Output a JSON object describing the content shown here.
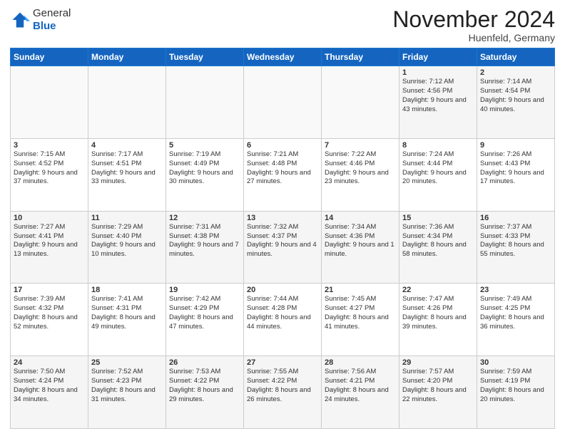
{
  "logo": {
    "general": "General",
    "blue": "Blue"
  },
  "title": "November 2024",
  "location": "Huenfeld, Germany",
  "headers": [
    "Sunday",
    "Monday",
    "Tuesday",
    "Wednesday",
    "Thursday",
    "Friday",
    "Saturday"
  ],
  "weeks": [
    [
      {
        "day": "",
        "info": ""
      },
      {
        "day": "",
        "info": ""
      },
      {
        "day": "",
        "info": ""
      },
      {
        "day": "",
        "info": ""
      },
      {
        "day": "",
        "info": ""
      },
      {
        "day": "1",
        "info": "Sunrise: 7:12 AM\nSunset: 4:56 PM\nDaylight: 9 hours and 43 minutes."
      },
      {
        "day": "2",
        "info": "Sunrise: 7:14 AM\nSunset: 4:54 PM\nDaylight: 9 hours and 40 minutes."
      }
    ],
    [
      {
        "day": "3",
        "info": "Sunrise: 7:15 AM\nSunset: 4:52 PM\nDaylight: 9 hours and 37 minutes."
      },
      {
        "day": "4",
        "info": "Sunrise: 7:17 AM\nSunset: 4:51 PM\nDaylight: 9 hours and 33 minutes."
      },
      {
        "day": "5",
        "info": "Sunrise: 7:19 AM\nSunset: 4:49 PM\nDaylight: 9 hours and 30 minutes."
      },
      {
        "day": "6",
        "info": "Sunrise: 7:21 AM\nSunset: 4:48 PM\nDaylight: 9 hours and 27 minutes."
      },
      {
        "day": "7",
        "info": "Sunrise: 7:22 AM\nSunset: 4:46 PM\nDaylight: 9 hours and 23 minutes."
      },
      {
        "day": "8",
        "info": "Sunrise: 7:24 AM\nSunset: 4:44 PM\nDaylight: 9 hours and 20 minutes."
      },
      {
        "day": "9",
        "info": "Sunrise: 7:26 AM\nSunset: 4:43 PM\nDaylight: 9 hours and 17 minutes."
      }
    ],
    [
      {
        "day": "10",
        "info": "Sunrise: 7:27 AM\nSunset: 4:41 PM\nDaylight: 9 hours and 13 minutes."
      },
      {
        "day": "11",
        "info": "Sunrise: 7:29 AM\nSunset: 4:40 PM\nDaylight: 9 hours and 10 minutes."
      },
      {
        "day": "12",
        "info": "Sunrise: 7:31 AM\nSunset: 4:38 PM\nDaylight: 9 hours and 7 minutes."
      },
      {
        "day": "13",
        "info": "Sunrise: 7:32 AM\nSunset: 4:37 PM\nDaylight: 9 hours and 4 minutes."
      },
      {
        "day": "14",
        "info": "Sunrise: 7:34 AM\nSunset: 4:36 PM\nDaylight: 9 hours and 1 minute."
      },
      {
        "day": "15",
        "info": "Sunrise: 7:36 AM\nSunset: 4:34 PM\nDaylight: 8 hours and 58 minutes."
      },
      {
        "day": "16",
        "info": "Sunrise: 7:37 AM\nSunset: 4:33 PM\nDaylight: 8 hours and 55 minutes."
      }
    ],
    [
      {
        "day": "17",
        "info": "Sunrise: 7:39 AM\nSunset: 4:32 PM\nDaylight: 8 hours and 52 minutes."
      },
      {
        "day": "18",
        "info": "Sunrise: 7:41 AM\nSunset: 4:31 PM\nDaylight: 8 hours and 49 minutes."
      },
      {
        "day": "19",
        "info": "Sunrise: 7:42 AM\nSunset: 4:29 PM\nDaylight: 8 hours and 47 minutes."
      },
      {
        "day": "20",
        "info": "Sunrise: 7:44 AM\nSunset: 4:28 PM\nDaylight: 8 hours and 44 minutes."
      },
      {
        "day": "21",
        "info": "Sunrise: 7:45 AM\nSunset: 4:27 PM\nDaylight: 8 hours and 41 minutes."
      },
      {
        "day": "22",
        "info": "Sunrise: 7:47 AM\nSunset: 4:26 PM\nDaylight: 8 hours and 39 minutes."
      },
      {
        "day": "23",
        "info": "Sunrise: 7:49 AM\nSunset: 4:25 PM\nDaylight: 8 hours and 36 minutes."
      }
    ],
    [
      {
        "day": "24",
        "info": "Sunrise: 7:50 AM\nSunset: 4:24 PM\nDaylight: 8 hours and 34 minutes."
      },
      {
        "day": "25",
        "info": "Sunrise: 7:52 AM\nSunset: 4:23 PM\nDaylight: 8 hours and 31 minutes."
      },
      {
        "day": "26",
        "info": "Sunrise: 7:53 AM\nSunset: 4:22 PM\nDaylight: 8 hours and 29 minutes."
      },
      {
        "day": "27",
        "info": "Sunrise: 7:55 AM\nSunset: 4:22 PM\nDaylight: 8 hours and 26 minutes."
      },
      {
        "day": "28",
        "info": "Sunrise: 7:56 AM\nSunset: 4:21 PM\nDaylight: 8 hours and 24 minutes."
      },
      {
        "day": "29",
        "info": "Sunrise: 7:57 AM\nSunset: 4:20 PM\nDaylight: 8 hours and 22 minutes."
      },
      {
        "day": "30",
        "info": "Sunrise: 7:59 AM\nSunset: 4:19 PM\nDaylight: 8 hours and 20 minutes."
      }
    ]
  ]
}
